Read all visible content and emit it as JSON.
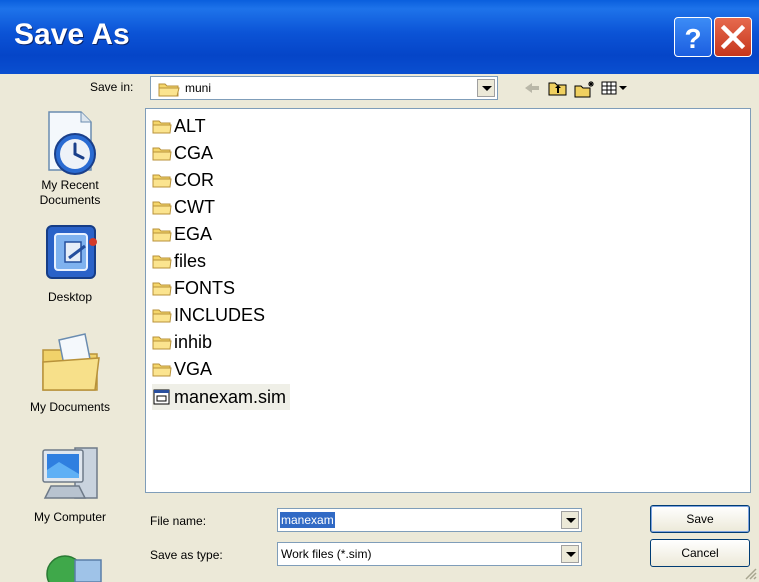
{
  "window": {
    "title": "Save As",
    "help_icon": "help-icon",
    "close_icon": "close-icon"
  },
  "toolbar": {
    "save_in_label": "Save in:",
    "save_in_value": "muni",
    "icons": [
      "back-icon",
      "up-folder-icon",
      "new-folder-icon",
      "view-menu-icon"
    ]
  },
  "places": [
    {
      "label": "My Recent\nDocuments",
      "icon": "recent-documents-icon"
    },
    {
      "label": "Desktop",
      "icon": "desktop-icon"
    },
    {
      "label": "My Documents",
      "icon": "my-documents-icon"
    },
    {
      "label": "My Computer",
      "icon": "my-computer-icon"
    },
    {
      "label": "",
      "icon": "network-places-icon"
    }
  ],
  "files": [
    {
      "name": "ALT",
      "type": "folder"
    },
    {
      "name": "CGA",
      "type": "folder"
    },
    {
      "name": "COR",
      "type": "folder"
    },
    {
      "name": "CWT",
      "type": "folder"
    },
    {
      "name": "EGA",
      "type": "folder"
    },
    {
      "name": "files",
      "type": "folder"
    },
    {
      "name": "FONTS",
      "type": "folder"
    },
    {
      "name": "INCLUDES",
      "type": "folder"
    },
    {
      "name": "inhib",
      "type": "folder"
    },
    {
      "name": "VGA",
      "type": "folder"
    },
    {
      "name": "manexam.sim",
      "type": "file"
    }
  ],
  "bottom": {
    "file_name_label": "File name:",
    "file_name_value": "manexam",
    "save_as_type_label": "Save as type:",
    "save_as_type_value": "Work files (*.sim)",
    "save_button": "Save",
    "cancel_button": "Cancel"
  },
  "colors": {
    "titlebar": "#0545c8",
    "dialog_bg": "#ece9d8",
    "selection": "#316ac5",
    "close_button": "#c6361c"
  }
}
